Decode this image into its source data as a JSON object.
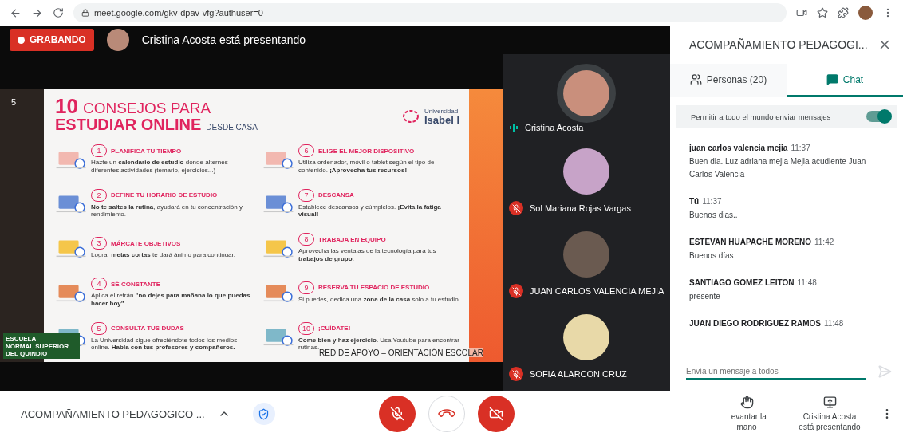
{
  "browser": {
    "url": "meet.google.com/gkv-dpav-vfg?authuser=0"
  },
  "stage": {
    "recording": "GRABANDO",
    "presenter": "Cristina Acosta está presentando"
  },
  "slide": {
    "page_number": "5",
    "title_number": "10",
    "title_rest": "CONSEJOS PARA",
    "title_line2": "ESTUDIAR ONLINE",
    "subtitle": "DESDE CASA",
    "university": [
      "Universidad",
      "Isabel I"
    ],
    "tips": [
      {
        "number": "1",
        "heading": "PLANIFICA TU TIEMPO",
        "body": "Hazte un **calendario de estudio** donde alternes diferentes actividades (temario, ejercicios...)"
      },
      {
        "number": "2",
        "heading": "DEFINE TU HORARIO DE ESTUDIO",
        "body": "**No te saltes la rutina**, ayudará en tu concentración y rendimiento."
      },
      {
        "number": "3",
        "heading": "MÁRCATE OBJETIVOS",
        "body": "Lograr **metas cortas** te dará ánimo para continuar."
      },
      {
        "number": "4",
        "heading": "SÉ CONSTANTE",
        "body": "Aplica el refrán **\"no dejes para mañana lo que puedas hacer hoy\"**."
      },
      {
        "number": "5",
        "heading": "CONSULTA TUS DUDAS",
        "body": "La Universidad sigue ofreciéndote todos los medios online. **Habla con tus profesores y compañeros.**"
      },
      {
        "number": "6",
        "heading": "ELIGE EL MEJOR DISPOSITIVO",
        "body": "Utiliza ordenador, móvil o tablet según el tipo de contenido. **¡Aprovecha tus recursos!**"
      },
      {
        "number": "7",
        "heading": "DESCANSA",
        "body": "Establece descansos y cúmplelos. **¡Evita la fatiga visual!**"
      },
      {
        "number": "8",
        "heading": "TRABAJA EN EQUIPO",
        "body": "Aprovecha las ventajas de la tecnología para tus **trabajos de grupo.**"
      },
      {
        "number": "9",
        "heading": "RESERVA TU ESPACIO DE ESTUDIO",
        "body": "Si puedes, dedica una **zona de la casa** solo a tu estudio."
      },
      {
        "number": "10",
        "heading": "¡CUÍDATE!",
        "body": "**Come bien y haz ejercicio.** Usa Youtube para encontrar rutinas."
      }
    ],
    "caption": "RED DE APOYO – ORIENTACIÓN ESCOLAR",
    "school_logo": [
      "ESCUELA",
      "NORMAL SUPERIOR",
      "DEL QUINDIO"
    ]
  },
  "participants": [
    {
      "name": "Cristina Acosta",
      "muted": false
    },
    {
      "name": "Sol Mariana Rojas Vargas",
      "muted": true
    },
    {
      "name": "JUAN CARLOS VALENCIA MEJIA",
      "muted": true
    },
    {
      "name": "SOFIA ALARCON CRUZ",
      "muted": true
    }
  ],
  "panel": {
    "title": "ACOMPAÑAMIENTO PEDAGOGI...",
    "tabs": [
      {
        "label": "Personas (20)",
        "kind": "people",
        "selected": false
      },
      {
        "label": "Chat",
        "kind": "chat",
        "selected": true
      }
    ],
    "toggle": {
      "label": "Permitir a todo el mundo enviar mensajes",
      "on": true
    },
    "messages": [
      {
        "sender": "juan carlos valencia mejia",
        "time": "11:37",
        "text": "Buen dia. Luz adriana mejia Mejia acudiente Juan Carlos Valencia"
      },
      {
        "sender": "Tú",
        "time": "11:37",
        "text": "Buenos dias.."
      },
      {
        "sender": "ESTEVAN HUAPACHE MORENO",
        "time": "11:42",
        "text": "Buenos días"
      },
      {
        "sender": "SANTIAGO GOMEZ LEITON",
        "time": "11:48",
        "text": "presente"
      },
      {
        "sender": "JUAN DIEGO RODRIGUEZ RAMOS",
        "time": "11:48"
      }
    ],
    "input_placeholder": "Envía un mensaje a todos"
  },
  "bottom_bar": {
    "meeting_title": "ACOMPAÑAMIENTO PEDAGOGICO ...",
    "controls": [
      {
        "kind": "mic",
        "on": false
      },
      {
        "kind": "hangup"
      },
      {
        "kind": "camera",
        "on": false
      }
    ],
    "actions": [
      {
        "kind": "hand",
        "label": "Levantar la mano"
      },
      {
        "kind": "present",
        "label": "Cristina Acosta está presentando"
      }
    ]
  }
}
